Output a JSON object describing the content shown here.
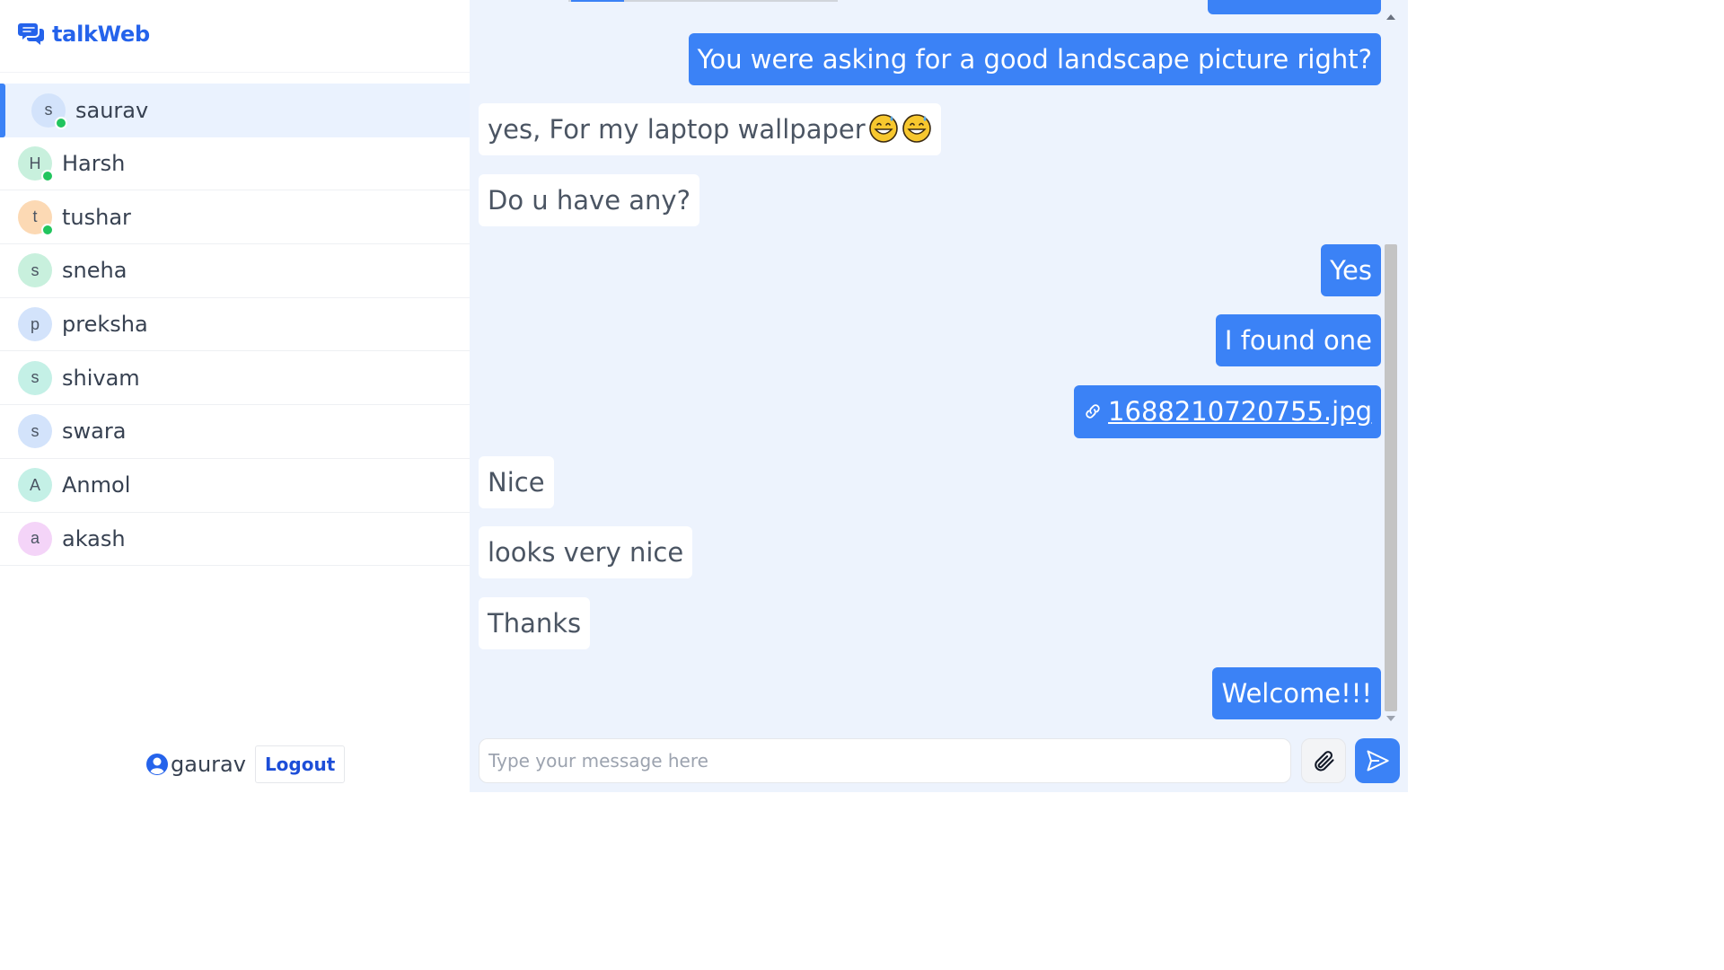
{
  "app": {
    "name": "talkWeb",
    "accent": "#3b82f6"
  },
  "contacts": [
    {
      "initial": "s",
      "name": "saurav",
      "online": true,
      "active": true,
      "color": "#d3e3fb"
    },
    {
      "initial": "H",
      "name": "Harsh",
      "online": true,
      "active": false,
      "color": "#c8f0dd"
    },
    {
      "initial": "t",
      "name": "tushar",
      "online": true,
      "active": false,
      "color": "#fcd9b4"
    },
    {
      "initial": "s",
      "name": "sneha",
      "online": false,
      "active": false,
      "color": "#c8f0dd"
    },
    {
      "initial": "p",
      "name": "preksha",
      "online": false,
      "active": false,
      "color": "#d3e3fb"
    },
    {
      "initial": "s",
      "name": "shivam",
      "online": false,
      "active": false,
      "color": "#c4f0e6"
    },
    {
      "initial": "s",
      "name": "swara",
      "online": false,
      "active": false,
      "color": "#d3e3fb"
    },
    {
      "initial": "A",
      "name": "Anmol",
      "online": false,
      "active": false,
      "color": "#c4f0e6"
    },
    {
      "initial": "a",
      "name": "akash",
      "online": false,
      "active": false,
      "color": "#f4d4f8"
    }
  ],
  "current_user": {
    "name": "gaurav",
    "logout_label": "Logout"
  },
  "messages": [
    {
      "direction": "out",
      "text": "You were asking for a good landscape picture right?"
    },
    {
      "direction": "in",
      "text": "yes, For my laptop wallpaper",
      "emoji": "grinning-sweat-face",
      "emoji_count": 2
    },
    {
      "direction": "in",
      "text": "Do u have any?"
    },
    {
      "direction": "out",
      "text": "Yes"
    },
    {
      "direction": "out",
      "text": "I found one"
    },
    {
      "direction": "out",
      "type": "file",
      "text": "1688210720755.jpg",
      "icon": "link-icon"
    },
    {
      "direction": "in",
      "text": "Nice"
    },
    {
      "direction": "in",
      "text": "looks very nice"
    },
    {
      "direction": "in",
      "text": "Thanks"
    },
    {
      "direction": "out",
      "text": "Welcome!!!"
    }
  ],
  "composer": {
    "placeholder": "Type your message here"
  }
}
